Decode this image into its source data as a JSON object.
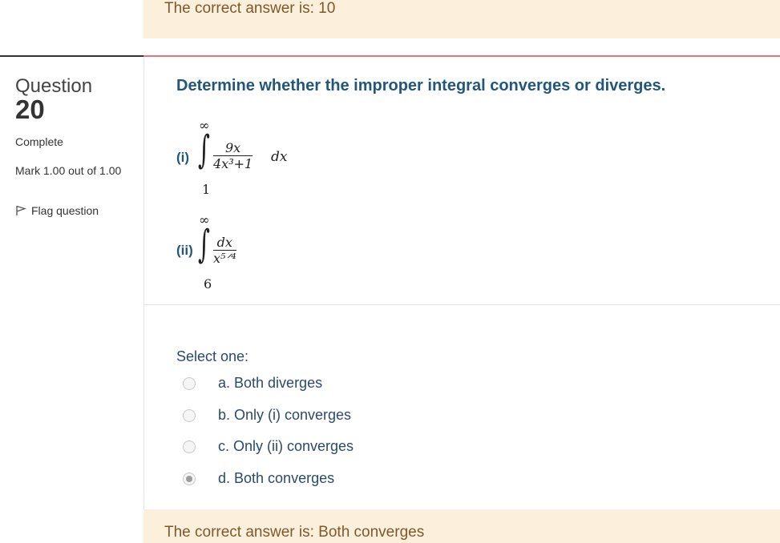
{
  "prev_question": {
    "feedback": "The correct answer is: 10"
  },
  "question": {
    "label": "Question",
    "number": "20",
    "state": "Complete",
    "grade": "Mark 1.00 out of 1.00",
    "flag_label": "Flag question",
    "text": "Determine whether the improper integral converges or diverges.",
    "parts": [
      {
        "label": "(i)",
        "upper": "∞",
        "lower": "1",
        "numerator": "9x",
        "denominator": "4x³+1",
        "differential": "dx"
      },
      {
        "label": "(ii)",
        "upper": "∞",
        "lower": "6",
        "numerator": "dx",
        "denominator": "x⁵ᐟ⁴"
      }
    ],
    "select_prompt": "Select one:",
    "options": [
      {
        "label": "a. Both diverges",
        "checked": false
      },
      {
        "label": "b. Only (i) converges",
        "checked": false
      },
      {
        "label": "c. Only (ii) converges",
        "checked": false
      },
      {
        "label": "d. Both converges",
        "checked": true
      }
    ],
    "feedback": "The correct answer is: Both converges"
  },
  "colors": {
    "question_text": "#23577a",
    "feedback_bg": "#fcefdc",
    "feedback_text": "#7d5a29",
    "divider_accent": "#e5747f"
  }
}
